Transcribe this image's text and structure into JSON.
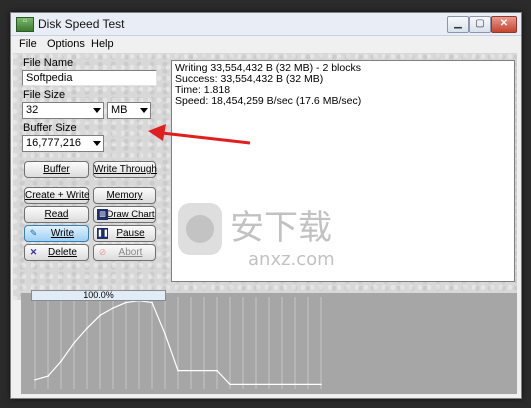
{
  "window": {
    "title": "Disk Speed Test",
    "icon_name": "drive-icon",
    "controls": {
      "minimize": "▁",
      "maximize": "▢",
      "close": "✕"
    }
  },
  "menu": [
    {
      "label": "File"
    },
    {
      "label": "Options"
    },
    {
      "label": "Help"
    }
  ],
  "form": {
    "file_name_label": "File Name",
    "file_name_value": "Softpedia",
    "file_size_label": "File Size",
    "file_size_value": "32",
    "file_size_unit": "MB",
    "buffer_size_label": "Buffer Size",
    "buffer_size_value": "16,777,216"
  },
  "buttons": {
    "buffer": "Buffer",
    "write_through": "Write Through",
    "create_write": "Create + Write",
    "memory": "Memory",
    "read": "Read",
    "draw_chart": "Draw Chart",
    "write": "Write",
    "pause": "Pause",
    "delete": "Delete",
    "abort": "Abort"
  },
  "output_lines": [
    "Writing 33,554,432 B (32 MB) - 2 blocks",
    "Success: 33,554,432 B (32 MB)",
    "Time: 1.818",
    "Speed:  18,454,259 B/sec (17.6 MB/sec)"
  ],
  "progress": {
    "label": "100.0%",
    "fraction": 1.0
  },
  "watermark": {
    "text": "安下载",
    "subtext": "anxz.com"
  },
  "colors": {
    "annotation_arrow": "#e02020",
    "chart_background": "#a6a6a6",
    "chart_grid": "#c6c6c6",
    "chart_line": "#ffffff"
  },
  "chart_data": {
    "type": "line",
    "x": [
      0,
      1,
      2,
      3,
      4,
      5,
      6,
      7,
      8,
      9,
      10,
      11,
      12,
      13,
      14,
      15,
      16,
      17,
      18,
      19,
      20,
      21,
      22
    ],
    "series": [
      {
        "values": [
          10,
          14,
          30,
          50,
          66,
          80,
          88,
          94,
          96,
          94,
          60,
          20,
          20,
          20,
          20,
          5,
          5,
          5,
          5,
          5,
          5,
          5,
          5
        ]
      }
    ],
    "ylim": [
      0,
      100
    ],
    "grid": true,
    "title": "",
    "xlabel": "",
    "ylabel": ""
  }
}
